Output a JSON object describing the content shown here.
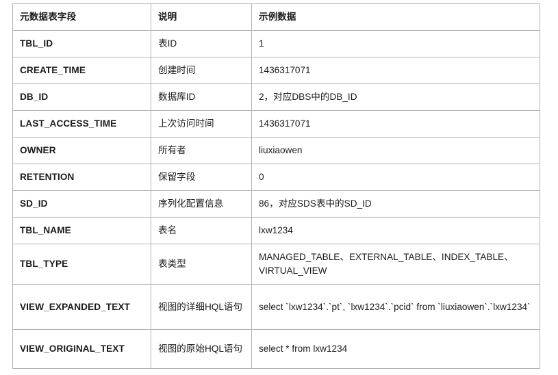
{
  "table": {
    "columns": [
      "元数据表字段",
      "说明",
      "示例数据"
    ],
    "accent_color": "#ff00ff",
    "border_color": "#b3b3b3",
    "text_color": "#1a1a1a",
    "rows": [
      {
        "field": "TBL_ID",
        "desc": "表ID",
        "sample": "1"
      },
      {
        "field": "CREATE_TIME",
        "desc": "创建时间",
        "sample": "1436317071"
      },
      {
        "field": "DB_ID",
        "desc": "数据库ID",
        "sample": "2，对应DBS中的DB_ID"
      },
      {
        "field": "LAST_ACCESS_TIME",
        "desc": "上次访问时间",
        "sample": "1436317071"
      },
      {
        "field": "OWNER",
        "desc": "所有者",
        "sample": "liuxiaowen"
      },
      {
        "field": "RETENTION",
        "desc": "保留字段",
        "sample": "0"
      },
      {
        "field": "SD_ID",
        "desc": "序列化配置信息",
        "sample": "86，对应SDS表中的SD_ID"
      },
      {
        "field": "TBL_NAME",
        "desc": "表名",
        "sample": "lxw1234"
      },
      {
        "field": "TBL_TYPE",
        "desc": "表类型",
        "sample": "MANAGED_TABLE、EXTERNAL_TABLE、INDEX_TABLE、VIRTUAL_VIEW"
      },
      {
        "field": "VIEW_EXPANDED_TEXT",
        "desc": "视图的详细HQL语句",
        "sample": "select `lxw1234`.`pt`, `lxw1234`.`pcid` from `liuxiaowen`.`lxw1234`"
      },
      {
        "field": "VIEW_ORIGINAL_TEXT",
        "desc": "视图的原始HQL语句",
        "sample": "select * from lxw1234"
      }
    ]
  }
}
